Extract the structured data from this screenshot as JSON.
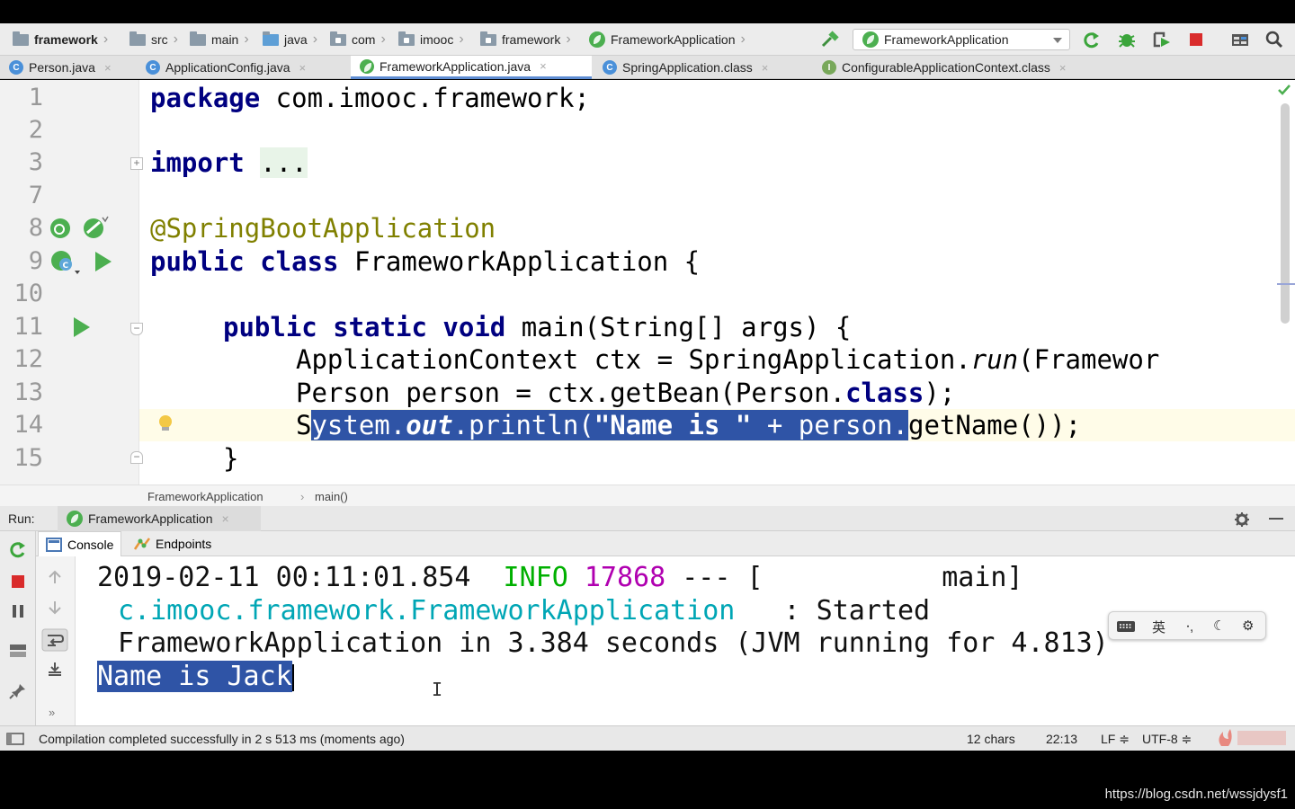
{
  "breadcrumb": [
    {
      "label": "framework",
      "bold": true
    },
    {
      "label": "src"
    },
    {
      "label": "main"
    },
    {
      "label": "java"
    },
    {
      "label": "com"
    },
    {
      "label": "imooc"
    },
    {
      "label": "framework"
    },
    {
      "label": "FrameworkApplication"
    }
  ],
  "run_config": {
    "selected": "FrameworkApplication"
  },
  "editor_tabs": [
    {
      "label": "Person.java",
      "close": "×"
    },
    {
      "label": "ApplicationConfig.java",
      "close": "×"
    },
    {
      "label": "FrameworkApplication.java",
      "close": "×",
      "active": true
    },
    {
      "label": "SpringApplication.class",
      "close": "×"
    },
    {
      "label": "ConfigurableApplicationContext.class",
      "close": "×"
    }
  ],
  "line_numbers": [
    "1",
    "2",
    "3",
    "7",
    "8",
    "9",
    "10",
    "11",
    "12",
    "13",
    "14",
    "15"
  ],
  "code": {
    "l1_kw": "package",
    "l1_rest": " com.imooc.framework;",
    "l3_kw": "import",
    "l3_fold": "...",
    "l8_ann": "@SpringBootApplication",
    "l9_kw": "public class",
    "l9_rest": " FrameworkApplication {",
    "l11_kw": "public static void",
    "l11_rest": " main(String[] args) {",
    "l12_a": "ApplicationContext ctx = SpringApplication.",
    "l12_run": "run",
    "l12_b": "(Framewor",
    "l13_a": "Person person = ctx.getBean(Person.",
    "l13_kw": "class",
    "l13_b": ");",
    "l14_s": "S",
    "l14_sel_a": "ystem.",
    "l14_out": "out",
    "l14_sel_b": ".println(",
    "l14_str": "\"Name is \"",
    "l14_sel_c": " + person.",
    "l14_tail": "getName());",
    "l15": "}"
  },
  "editor_breadcrumb": {
    "class": "FrameworkApplication",
    "method": "main()",
    "sep": "›"
  },
  "run_panel": {
    "label": "Run:",
    "tab": "FrameworkApplication",
    "close": "×",
    "subtabs": [
      "Console",
      "Endpoints"
    ]
  },
  "console": {
    "timestamp": "2019-02-11 00:11:01.854",
    "level": "INFO",
    "pid": "17868",
    "dashes": "---",
    "thread": "[           main]",
    "logger": "c.imooc.framework.FrameworkApplication",
    "colon_msg": "   : Started",
    "started_line": "FrameworkApplication in 3.384 seconds (JVM running for 4.813)",
    "output": "Name is Jack"
  },
  "ime": {
    "items": [
      "英",
      "⸱,",
      "☾",
      "⚙"
    ]
  },
  "status": {
    "message": "Compilation completed successfully in 2 s 513 ms (moments ago)",
    "chars": "12 chars",
    "position": "22:13",
    "line_sep": "LF ≑",
    "encoding": "UTF-8 ≑"
  },
  "watermark": "https://blog.csdn.net/wssjdysf1",
  "colors": {
    "selection": "#2f54a6",
    "info": "#00b000",
    "pid": "#b000b0",
    "logger": "#00a6b5",
    "keyword": "#000080",
    "annotation": "#808000"
  }
}
